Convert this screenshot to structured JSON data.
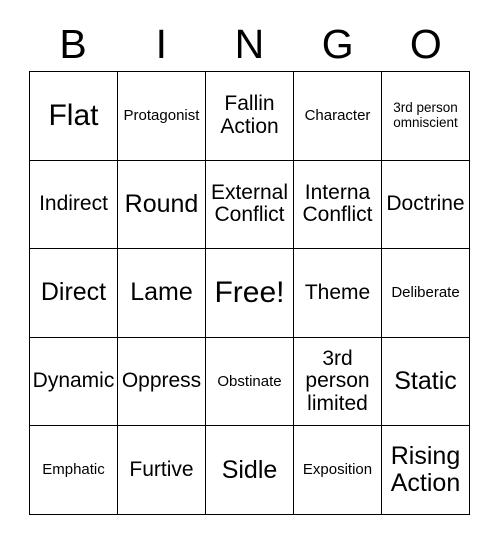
{
  "card": {
    "header_letters": [
      "B",
      "I",
      "N",
      "G",
      "O"
    ],
    "border_color": "#000000",
    "background_color": "#ffffff",
    "text_color": "#000000",
    "rows": 5,
    "columns": 5
  },
  "cells": [
    {
      "text": "Flat",
      "size": "fs-xl",
      "free": false
    },
    {
      "text": "Protagonist",
      "size": "fs-sm",
      "free": false
    },
    {
      "text": "Fallin Action",
      "size": "fs-md",
      "free": false
    },
    {
      "text": "Character",
      "size": "fs-sm",
      "free": false
    },
    {
      "text": "3rd person omniscient",
      "size": "fs-xs",
      "free": false
    },
    {
      "text": "Indirect",
      "size": "fs-md",
      "free": false
    },
    {
      "text": "Round",
      "size": "fs-lg",
      "free": false
    },
    {
      "text": "External Conflict",
      "size": "fs-md",
      "free": false
    },
    {
      "text": "Interna Conflict",
      "size": "fs-md",
      "free": false
    },
    {
      "text": "Doctrine",
      "size": "fs-md",
      "free": false
    },
    {
      "text": "Direct",
      "size": "fs-lg",
      "free": false
    },
    {
      "text": "Lame",
      "size": "fs-lg",
      "free": false
    },
    {
      "text": "Free!",
      "size": "fs-xl",
      "free": true
    },
    {
      "text": "Theme",
      "size": "fs-md",
      "free": false
    },
    {
      "text": "Deliberate",
      "size": "fs-sm",
      "free": false
    },
    {
      "text": "Dynamic",
      "size": "fs-md",
      "free": false
    },
    {
      "text": "Oppress",
      "size": "fs-md",
      "free": false
    },
    {
      "text": "Obstinate",
      "size": "fs-sm",
      "free": false
    },
    {
      "text": "3rd person limited",
      "size": "fs-md",
      "free": false
    },
    {
      "text": "Static",
      "size": "fs-lg",
      "free": false
    },
    {
      "text": "Emphatic",
      "size": "fs-sm",
      "free": false
    },
    {
      "text": "Furtive",
      "size": "fs-md",
      "free": false
    },
    {
      "text": "Sidle",
      "size": "fs-lg",
      "free": false
    },
    {
      "text": "Exposition",
      "size": "fs-sm",
      "free": false
    },
    {
      "text": "Rising Action",
      "size": "fs-lg",
      "free": false
    }
  ]
}
